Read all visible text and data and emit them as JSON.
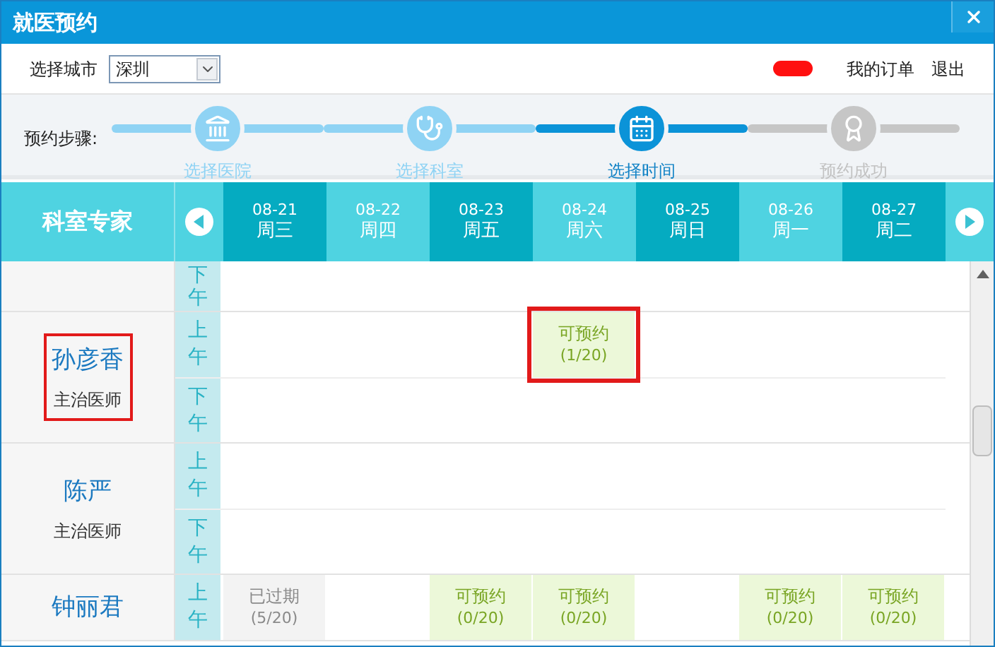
{
  "window": {
    "title": "就医预约"
  },
  "toolbar": {
    "city_label": "选择城市",
    "city": "深圳",
    "links": [
      "我的订单",
      "退出"
    ]
  },
  "steps": {
    "label": "预约步骤:",
    "items": [
      {
        "label": "选择医院",
        "completed": true,
        "selected": false
      },
      {
        "label": "选择科室",
        "completed": true,
        "selected": false
      },
      {
        "label": "选择时间",
        "completed": false,
        "selected": true
      },
      {
        "label": "预约成功",
        "completed": false,
        "selected": false
      }
    ]
  },
  "schedule": {
    "header": "科室专家",
    "days": [
      {
        "date": "08-21",
        "weekday": "周三"
      },
      {
        "date": "08-22",
        "weekday": "周四"
      },
      {
        "date": "08-23",
        "weekday": "周五"
      },
      {
        "date": "08-24",
        "weekday": "周六"
      },
      {
        "date": "08-25",
        "weekday": "周日"
      },
      {
        "date": "08-26",
        "weekday": "周一"
      },
      {
        "date": "08-27",
        "weekday": "周二"
      }
    ],
    "rows": [
      {
        "slots": [
          {
            "period": "下午",
            "cells": [
              null,
              null,
              null,
              null,
              null,
              null,
              null
            ]
          }
        ]
      },
      {
        "name": "孙彦香",
        "title": "主治医师",
        "annotated": true,
        "slots": [
          {
            "period": "上午",
            "cells": [
              null,
              null,
              null,
              {
                "kind": "available",
                "text": "可预约",
                "count": "(1/20)",
                "annotated": true
              },
              null,
              null,
              null
            ]
          },
          {
            "period": "下午",
            "cells": [
              null,
              null,
              null,
              null,
              null,
              null,
              null
            ]
          }
        ]
      },
      {
        "name": "陈严",
        "title": "主治医师",
        "annotated": false,
        "slots": [
          {
            "period": "上午",
            "cells": [
              null,
              null,
              null,
              null,
              null,
              null,
              null
            ]
          },
          {
            "period": "下午",
            "cells": [
              null,
              null,
              null,
              null,
              null,
              null,
              null
            ]
          }
        ]
      },
      {
        "name": "钟丽君",
        "annotated": false,
        "slots": [
          {
            "period": "上午",
            "cells": [
              {
                "kind": "expired",
                "text": "已过期",
                "count": "(5/20)",
                "annotated": false
              },
              null,
              {
                "kind": "available",
                "text": "可预约",
                "count": "(0/20)",
                "annotated": false
              },
              {
                "kind": "available",
                "text": "可预约",
                "count": "(0/20)",
                "annotated": false
              },
              null,
              {
                "kind": "available",
                "text": "可预约",
                "count": "(0/20)",
                "annotated": false
              },
              {
                "kind": "available",
                "text": "可预约",
                "count": "(0/20)",
                "annotated": false
              }
            ]
          }
        ]
      }
    ]
  }
}
